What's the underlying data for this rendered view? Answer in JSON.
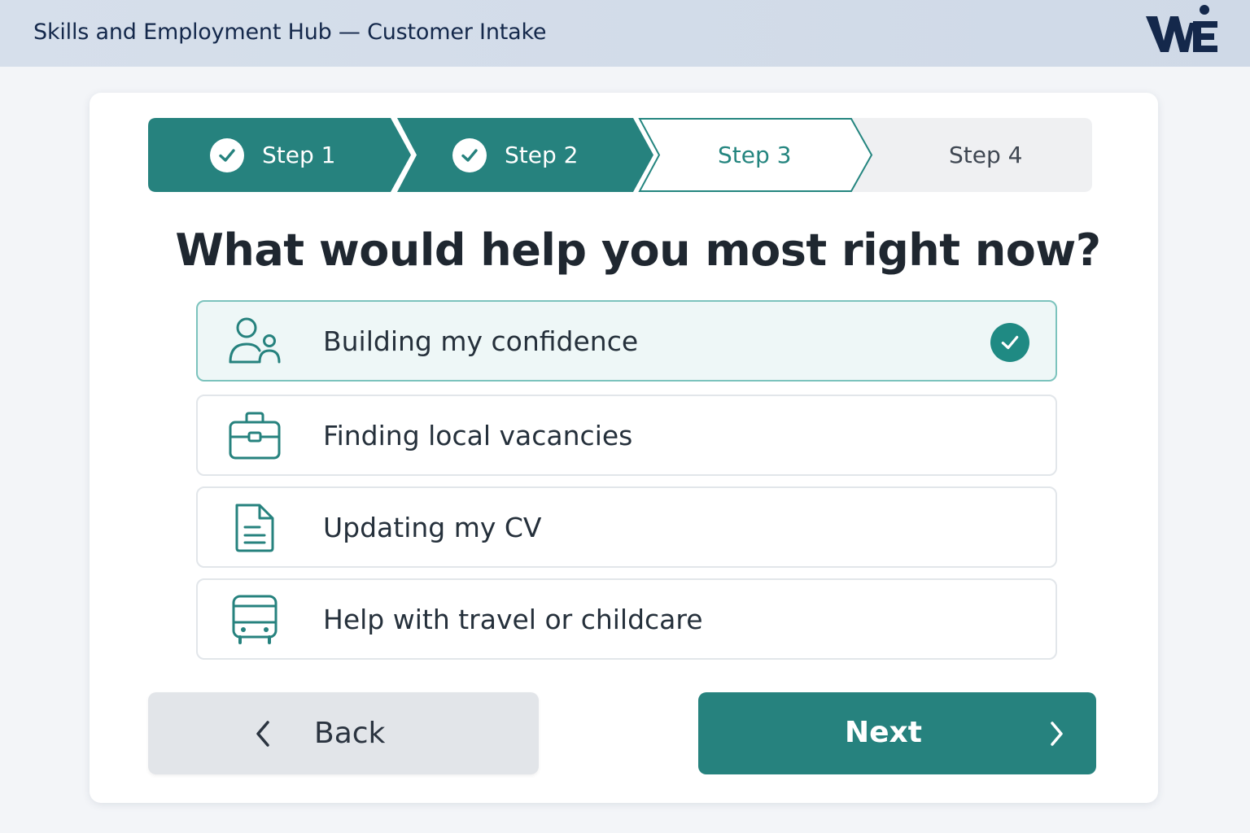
{
  "header": {
    "title": "Skills and Employment Hub — Customer Intake",
    "logo_icon": "we-logo"
  },
  "stepper": {
    "steps": [
      {
        "label": "Step 1",
        "state": "complete"
      },
      {
        "label": "Step 2",
        "state": "complete"
      },
      {
        "label": "Step 3",
        "state": "current"
      },
      {
        "label": "Step 4",
        "state": "upcoming"
      }
    ]
  },
  "question": "What would help you most right now?",
  "options": [
    {
      "label": "Building my confidence",
      "icon": "people-icon",
      "selected": true
    },
    {
      "label": "Finding local vacancies",
      "icon": "briefcase-icon",
      "selected": false
    },
    {
      "label": "Updating my CV",
      "icon": "document-icon",
      "selected": false
    },
    {
      "label": "Help with travel or childcare",
      "icon": "bus-icon",
      "selected": false
    }
  ],
  "buttons": {
    "back_label": "Back",
    "next_label": "Next"
  },
  "colors": {
    "accent": "#26827e",
    "brand_navy": "#14284b",
    "selected_bg": "#eef7f7"
  }
}
